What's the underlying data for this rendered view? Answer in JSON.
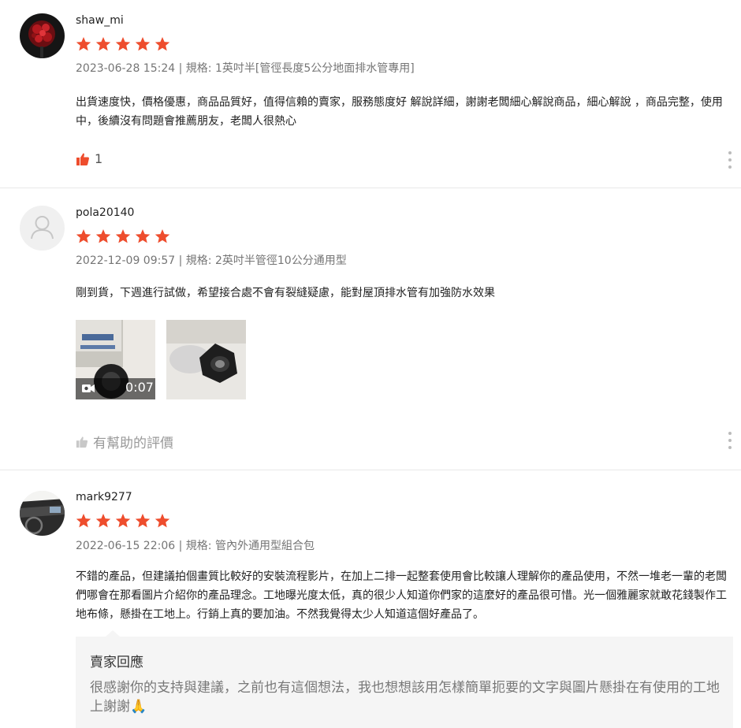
{
  "reviews": [
    {
      "username": "shaw_mi",
      "rating": 5,
      "date": "2023-06-28 15:24",
      "variation_label": "規格:",
      "variation": "1英吋半[管徑長度5公分地面排水管專用]",
      "meta_separator": "|",
      "text": "出貨速度快，價格優惠，商品品質好，值得信賴的賣家，服務態度好 解說詳細，謝謝老闆細心解說商品，細心解說 ，商品完整，使用中，後續沒有問題會推薦朋友，老闆人很熱心",
      "like_count": "1",
      "avatar_icon": "red-bouquet-photo"
    },
    {
      "username": "pola20140",
      "rating": 5,
      "date": "2022-12-09 09:57",
      "variation_label": "規格:",
      "variation": "2英吋半管徑10公分通用型",
      "meta_separator": "|",
      "text": "剛到貨，下週進行試做，希望接合處不會有裂縫疑慮，能對屋頂排水管有加強防水效果",
      "video_duration": "0:07",
      "helpful_label": "有幫助的評價",
      "avatar_icon": "default-user-icon"
    },
    {
      "username": "mark9277",
      "rating": 5,
      "date": "2022-06-15 22:06",
      "variation_label": "規格:",
      "variation": "管內外通用型組合包",
      "meta_separator": "|",
      "text": "不錯的產品，但建議拍個畫質比較好的安裝流程影片，在加上二排一起整套使用會比較讓人理解你的產品使用，不然一堆老一輩的老闆們哪會在那看圖片介紹你的產品理念。工地曝光度太低，真的很少人知道你們家的這麼好的產品很可惜。光一個雅麗家就敢花錢製作工地布條，懸掛在工地上。行銷上真的要加油。不然我覺得太少人知道這個好產品了。",
      "avatar_icon": "car-interior-photo",
      "seller_reply": {
        "title": "賣家回應",
        "text": "很感謝你的支持與建議，之前也有這個想法，我也想想該用怎樣簡單扼要的文字與圖片懸掛在有使用的工地上謝謝🙏"
      }
    }
  ],
  "colors": {
    "star": "#ee4d2d",
    "like_active": "#ee4d2d",
    "muted": "#757575",
    "separator": "#e8e8e8"
  }
}
